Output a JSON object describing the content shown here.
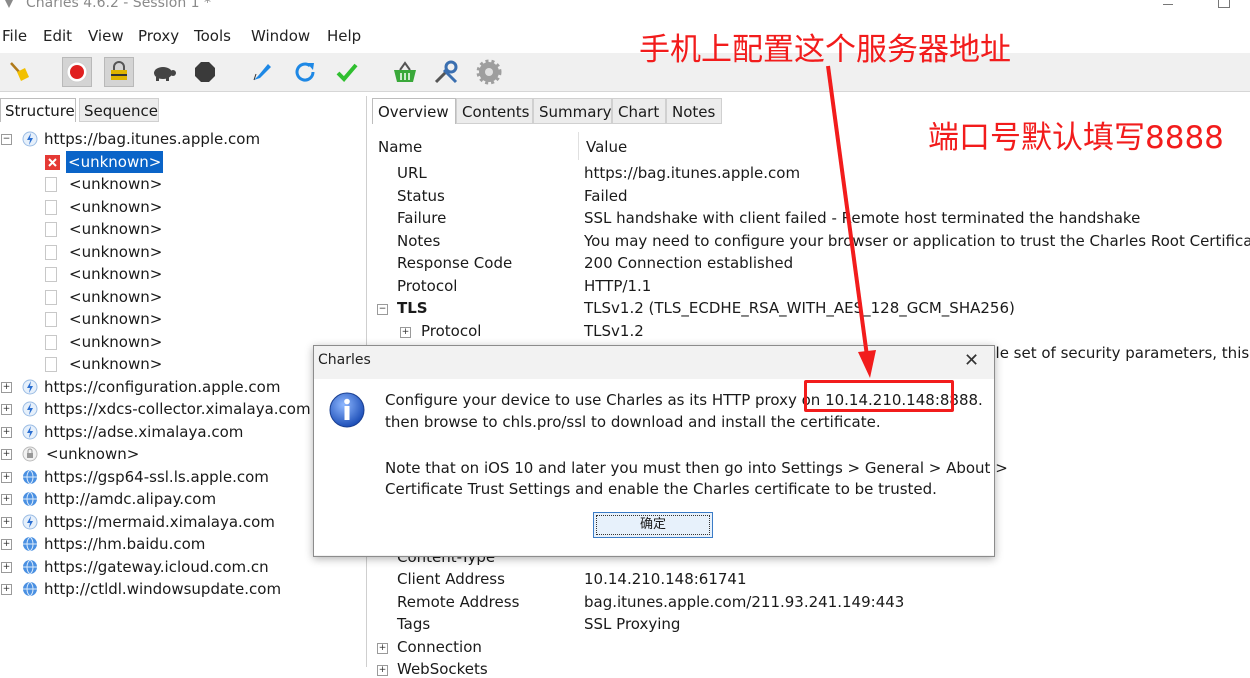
{
  "window": {
    "title": "Charles 4.6.2 - Session 1 *"
  },
  "menu": [
    "File",
    "Edit",
    "View",
    "Proxy",
    "Tools",
    "Window",
    "Help"
  ],
  "toolbar": {
    "icons": [
      "broom-icon",
      "record-icon",
      "throttle-lock-icon",
      "turtle-icon",
      "stop-hexagon-icon",
      "compose-pen-icon",
      "refresh-icon",
      "validate-check-icon",
      "basket-icon",
      "tools-icon",
      "settings-gear-icon"
    ],
    "colors": {
      "record": "#e02020",
      "refresh": "#1e88e5",
      "check": "#2fbf2f",
      "basket": "#3aa83a"
    }
  },
  "left_tabs": [
    "Structure",
    "Sequence"
  ],
  "tree": {
    "root": "https://bag.itunes.apple.com",
    "children": [
      "<unknown>",
      "<unknown>",
      "<unknown>",
      "<unknown>",
      "<unknown>",
      "<unknown>",
      "<unknown>",
      "<unknown>",
      "<unknown>",
      "<unknown>"
    ],
    "hosts": [
      {
        "label": "https://configuration.apple.com",
        "icon": "bolt"
      },
      {
        "label": "https://xdcs-collector.ximalaya.com",
        "icon": "bolt"
      },
      {
        "label": "https://adse.ximalaya.com",
        "icon": "bolt"
      },
      {
        "label": "<unknown>",
        "icon": "lock"
      },
      {
        "label": "https://gsp64-ssl.ls.apple.com",
        "icon": "globe"
      },
      {
        "label": "http://amdc.alipay.com",
        "icon": "globe"
      },
      {
        "label": "https://mermaid.ximalaya.com",
        "icon": "bolt"
      },
      {
        "label": "https://hm.baidu.com",
        "icon": "globe"
      },
      {
        "label": "https://gateway.icloud.com.cn",
        "icon": "globe"
      },
      {
        "label": "http://ctldl.windowsupdate.com",
        "icon": "globe"
      }
    ]
  },
  "right_tabs": [
    "Overview",
    "Contents",
    "Summary",
    "Chart",
    "Notes"
  ],
  "columns": {
    "name": "Name",
    "value": "Value"
  },
  "overview": [
    {
      "name": "URL",
      "value": "https://bag.itunes.apple.com"
    },
    {
      "name": "Status",
      "value": "Failed"
    },
    {
      "name": "Failure",
      "value": "SSL handshake with client failed - Remote host terminated the handshake"
    },
    {
      "name": "Notes",
      "value": "You may need to configure your browser or application to trust the Charles Root Certificate"
    },
    {
      "name": "Response Code",
      "value": "200 Connection established"
    },
    {
      "name": "Protocol",
      "value": "HTTP/1.1"
    },
    {
      "name": "TLS",
      "value": "TLSv1.2 (TLS_ECDHE_RSA_WITH_AES_128_GCM_SHA256)"
    },
    {
      "name": "Protocol",
      "value": "TLSv1.2"
    }
  ],
  "hidden_partial": "ble set of security parameters, this p",
  "overview_lower": [
    {
      "name": "Content-Type",
      "value": ""
    },
    {
      "name": "Client Address",
      "value": "10.14.210.148:61741"
    },
    {
      "name": "Remote Address",
      "value": "bag.itunes.apple.com/211.93.241.149:443"
    },
    {
      "name": "Tags",
      "value": "SSL Proxying"
    },
    {
      "name": "Connection",
      "value": ""
    },
    {
      "name": "WebSockets",
      "value": ""
    }
  ],
  "dialog": {
    "title": "Charles",
    "line1": "Configure your device to use Charles as its HTTP proxy on ",
    "ip": "10.14.210.148:8888",
    "line1_end": ".",
    "line2": "then browse to chls.pro/ssl to download and install the certificate.",
    "line3": "Note that on iOS 10 and later you must then go into Settings > General > About >",
    "line4": "Certificate Trust Settings and enable the Charles certificate to be trusted.",
    "ok": "确定"
  },
  "annotations": {
    "top": "手机上配置这个服务器地址",
    "right": "端口号默认填写8888",
    "color": "#f21c1c"
  }
}
